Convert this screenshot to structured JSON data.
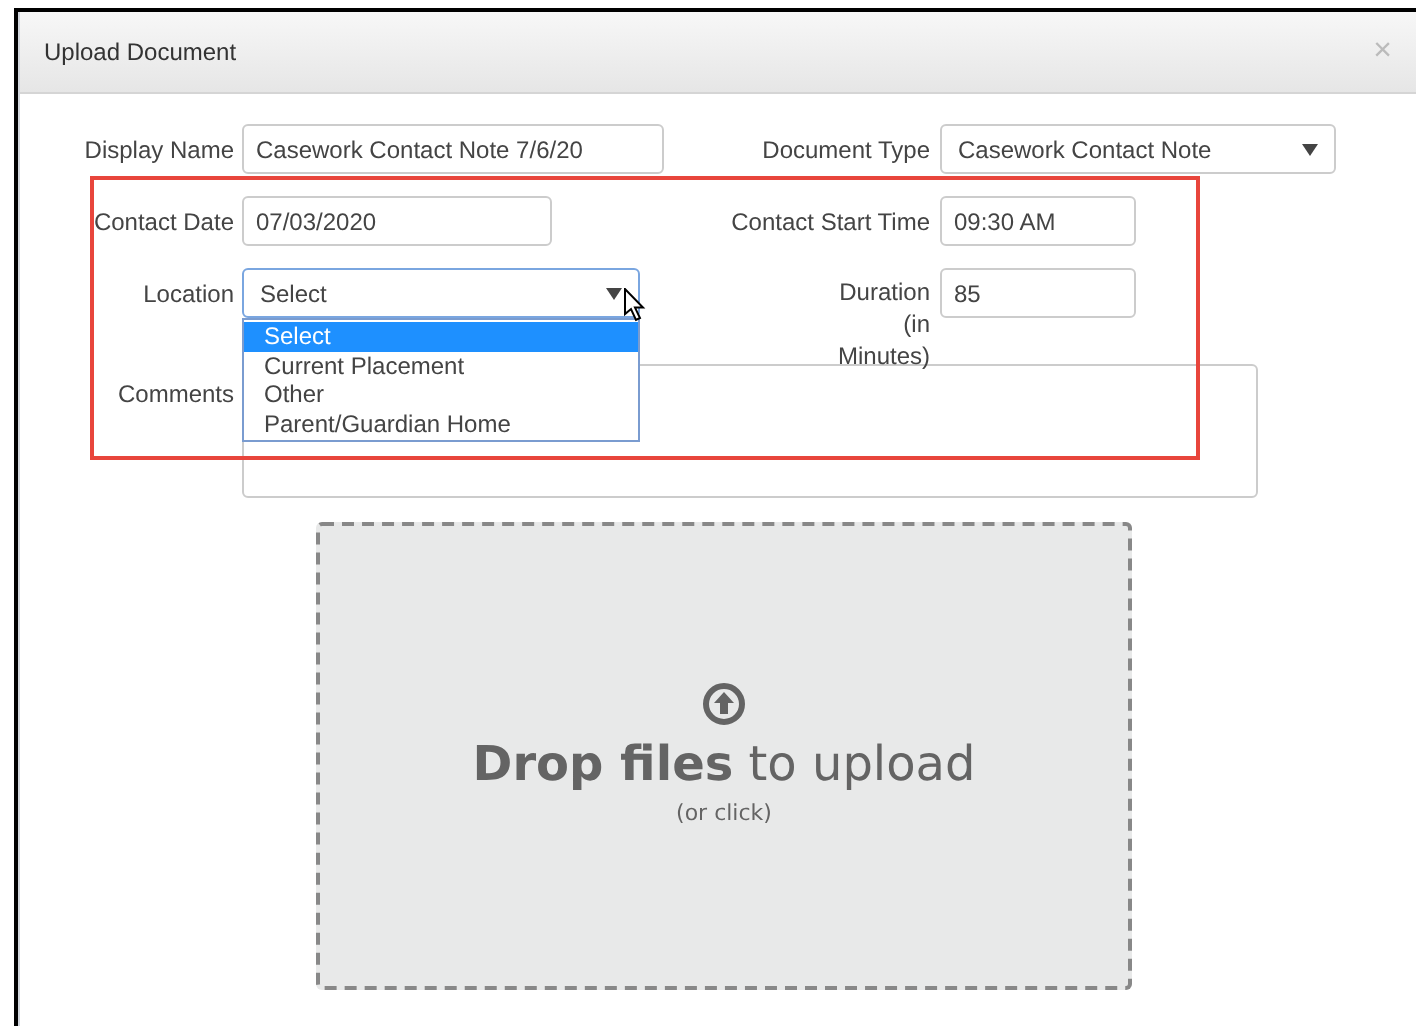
{
  "dialog": {
    "title": "Upload Document",
    "close": "×"
  },
  "display_name": {
    "label": "Display Name",
    "value": "Casework Contact Note 7/6/20"
  },
  "document_type": {
    "label": "Document Type",
    "value": "Casework Contact Note"
  },
  "contact_date": {
    "label": "Contact Date",
    "value": "07/03/2020"
  },
  "contact_start_time": {
    "label": "Contact Start Time",
    "value": "09:30 AM"
  },
  "location": {
    "label": "Location",
    "value": "Select",
    "expanded": true,
    "options": [
      {
        "label": "Select",
        "selected": true
      },
      {
        "label": "Current Placement",
        "selected": false
      },
      {
        "label": "Other",
        "selected": false
      },
      {
        "label": "Parent/Guardian Home",
        "selected": false
      }
    ]
  },
  "duration": {
    "label": "Duration (in Minutes)",
    "value": "85"
  },
  "comments": {
    "label": "Comments"
  },
  "dropzone": {
    "title": "**Drop files** to upload",
    "hint": "(or click)"
  }
}
